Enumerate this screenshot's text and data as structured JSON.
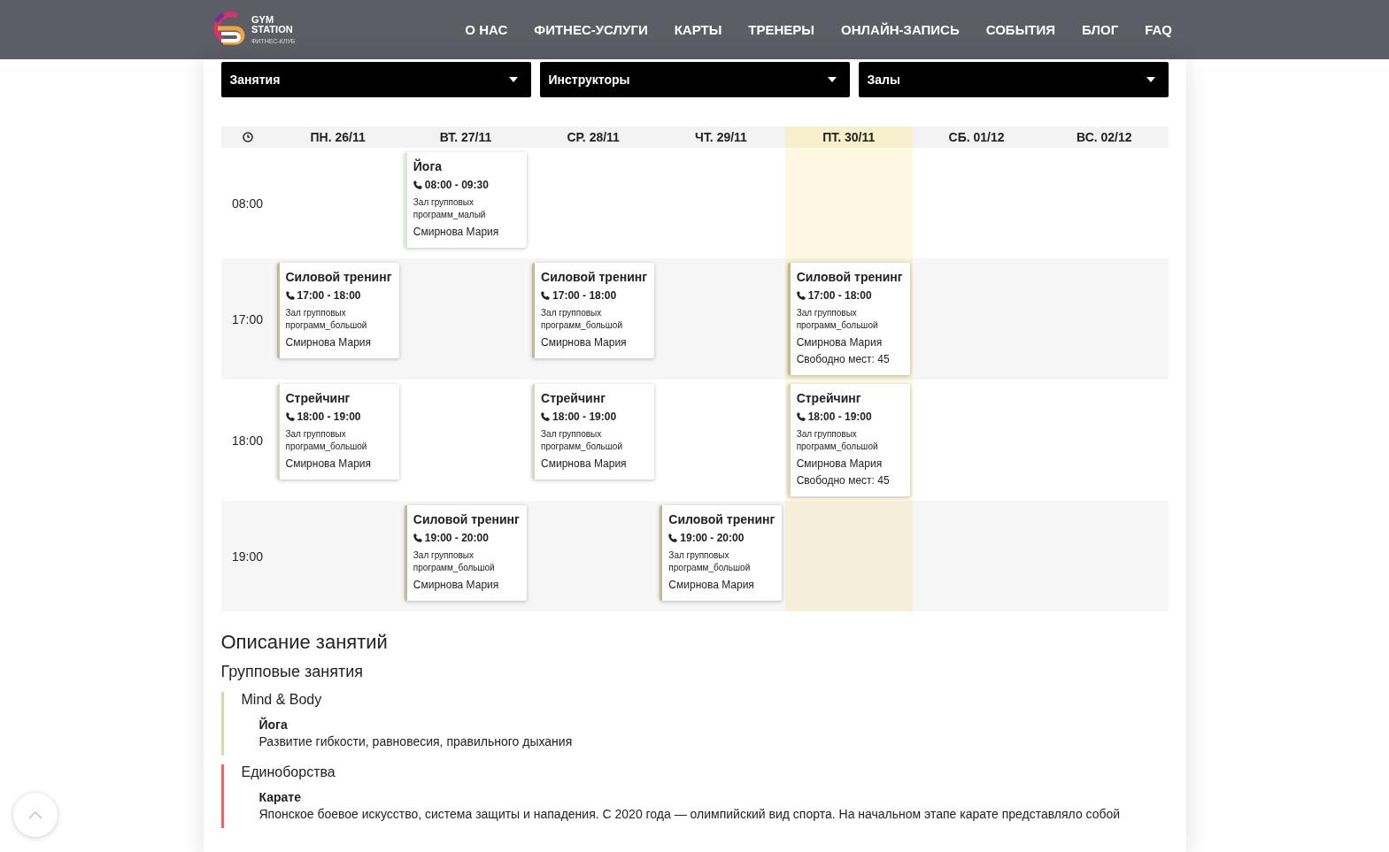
{
  "header": {
    "logo_line1": "GYM",
    "logo_line2": "STATION",
    "logo_tagline": "ФИТНЕС-КЛУБ",
    "nav": [
      "О НАС",
      "ФИТНЕС-УСЛУГИ",
      "КАРТЫ",
      "ТРЕНЕРЫ",
      "ОНЛАЙН-ЗАПИСЬ",
      "СОБЫТИЯ",
      "БЛОГ",
      "FAQ"
    ]
  },
  "filters": [
    {
      "label": "Занятия"
    },
    {
      "label": "Инструкторы"
    },
    {
      "label": "Залы"
    }
  ],
  "schedule": {
    "days": [
      {
        "label": "ПН. 26/11",
        "selected": false
      },
      {
        "label": "ВТ. 27/11",
        "selected": false
      },
      {
        "label": "СР. 28/11",
        "selected": false
      },
      {
        "label": "ЧТ. 29/11",
        "selected": false
      },
      {
        "label": "ПТ. 30/11",
        "selected": true
      },
      {
        "label": "СБ. 01/12",
        "selected": false
      },
      {
        "label": "ВС. 02/12",
        "selected": false
      }
    ],
    "rows": [
      {
        "time": "08:00",
        "slots": [
          {
            "kind": "empty"
          },
          {
            "kind": "class",
            "title": "Йога",
            "time": "08:00 - 09:30",
            "hall": "Зал групповых программ_малый",
            "instructor": "Смирнова Мария",
            "color": "#c9f2c9"
          },
          {
            "kind": "empty"
          },
          {
            "kind": "empty"
          },
          {
            "kind": "empty"
          },
          {
            "kind": "empty"
          },
          {
            "kind": "empty"
          }
        ]
      },
      {
        "time": "17:00",
        "slots": [
          {
            "kind": "class",
            "title": "Силовой тренинг",
            "time": "17:00 - 18:00",
            "hall": "Зал групповых программ_большой",
            "instructor": "Смирнова Мария",
            "color": "#c8b88a"
          },
          {
            "kind": "empty"
          },
          {
            "kind": "class",
            "title": "Силовой тренинг",
            "time": "17:00 - 18:00",
            "hall": "Зал групповых программ_большой",
            "instructor": "Смирнова Мария",
            "color": "#c8b88a"
          },
          {
            "kind": "empty"
          },
          {
            "kind": "class",
            "title": "Силовой тренинг",
            "time": "17:00 - 18:00",
            "hall": "Зал групповых программ_большой",
            "instructor": "Смирнова Мария",
            "free": "Свободно мест: 45",
            "color": "#c8b88a"
          },
          {
            "kind": "empty"
          },
          {
            "kind": "empty"
          }
        ]
      },
      {
        "time": "18:00",
        "slots": [
          {
            "kind": "class",
            "title": "Стрейчинг",
            "time": "18:00 - 19:00",
            "hall": "Зал групповых программ_большой",
            "instructor": "Смирнова Мария",
            "color": "#d9d4c4"
          },
          {
            "kind": "empty"
          },
          {
            "kind": "class",
            "title": "Стрейчинг",
            "time": "18:00 - 19:00",
            "hall": "Зал групповых программ_большой",
            "instructor": "Смирнова Мария",
            "color": "#d9d4c4"
          },
          {
            "kind": "empty"
          },
          {
            "kind": "class",
            "title": "Стрейчинг",
            "time": "18:00 - 19:00",
            "hall": "Зал групповых программ_большой",
            "instructor": "Смирнова Мария",
            "free": "Свободно мест: 45",
            "color": "#d9d4c4"
          },
          {
            "kind": "empty"
          },
          {
            "kind": "empty"
          }
        ]
      },
      {
        "time": "19:00",
        "slots": [
          {
            "kind": "empty"
          },
          {
            "kind": "class",
            "title": "Силовой тренинг",
            "time": "19:00 - 20:00",
            "hall": "Зал групповых программ_большой",
            "instructor": "Смирнова Мария",
            "color": "#c8b88a"
          },
          {
            "kind": "empty"
          },
          {
            "kind": "class",
            "title": "Силовой тренинг",
            "time": "19:00 - 20:00",
            "hall": "Зал групповых программ_большой",
            "instructor": "Смирнова Мария",
            "color": "#c8b88a"
          },
          {
            "kind": "empty"
          },
          {
            "kind": "empty"
          },
          {
            "kind": "empty"
          }
        ]
      }
    ]
  },
  "description": {
    "title": "Описание занятий",
    "subtitle": "Групповые занятия",
    "groups": [
      {
        "name": "Mind & Body",
        "color": "#c5e3b0",
        "items": [
          {
            "name": "Йога",
            "text": "Развитие гибкости, равновесия, правильного дыхания"
          }
        ]
      },
      {
        "name": "Единоборства",
        "color": "#e06b6b",
        "items": [
          {
            "name": "Карате",
            "text": "Японское боевое искусство, система защиты и нападения. С 2020 года — олимпийский вид спорта. На начальном этапе карате представляло собой"
          }
        ]
      }
    ]
  }
}
